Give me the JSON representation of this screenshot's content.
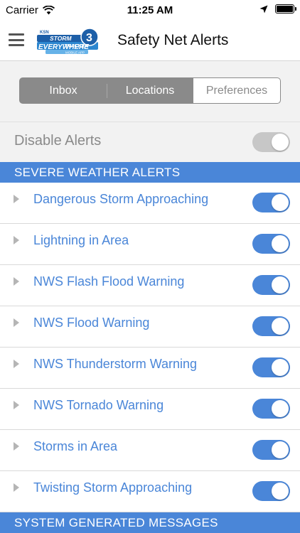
{
  "status_bar": {
    "carrier": "Carrier",
    "time": "11:25 AM"
  },
  "nav": {
    "title": "Safety Net Alerts",
    "logo": {
      "station": "KSN",
      "line1": "STORM",
      "line2": "TRACKER",
      "number": "3",
      "line3": "EVERYWHERE",
      "line4": "MOBILE APP"
    }
  },
  "tabs": [
    {
      "label": "Inbox",
      "active": false
    },
    {
      "label": "Locations",
      "active": false
    },
    {
      "label": "Preferences",
      "active": true
    }
  ],
  "disable_alerts": {
    "label": "Disable Alerts",
    "enabled": false
  },
  "sections": {
    "severe": "SEVERE WEATHER ALERTS",
    "system": "SYSTEM GENERATED MESSAGES"
  },
  "alerts": [
    {
      "label": "Dangerous Storm Approaching",
      "enabled": true
    },
    {
      "label": "Lightning in Area",
      "enabled": true
    },
    {
      "label": "NWS Flash Flood Warning",
      "enabled": true
    },
    {
      "label": "NWS Flood Warning",
      "enabled": true
    },
    {
      "label": "NWS Thunderstorm Warning",
      "enabled": true
    },
    {
      "label": "NWS Tornado Warning",
      "enabled": true
    },
    {
      "label": "Storms in Area",
      "enabled": true
    },
    {
      "label": "Twisting Storm Approaching",
      "enabled": true
    }
  ],
  "colors": {
    "accent": "#4a86d8",
    "toggle_off": "#c7c7c7",
    "segment_gray": "#8a8a8a"
  },
  "icons": {
    "menu": "hamburger-icon",
    "wifi": "wifi-icon",
    "location": "location-arrow-icon",
    "battery": "battery-icon",
    "row_expand": "disclosure-triangle-icon"
  }
}
